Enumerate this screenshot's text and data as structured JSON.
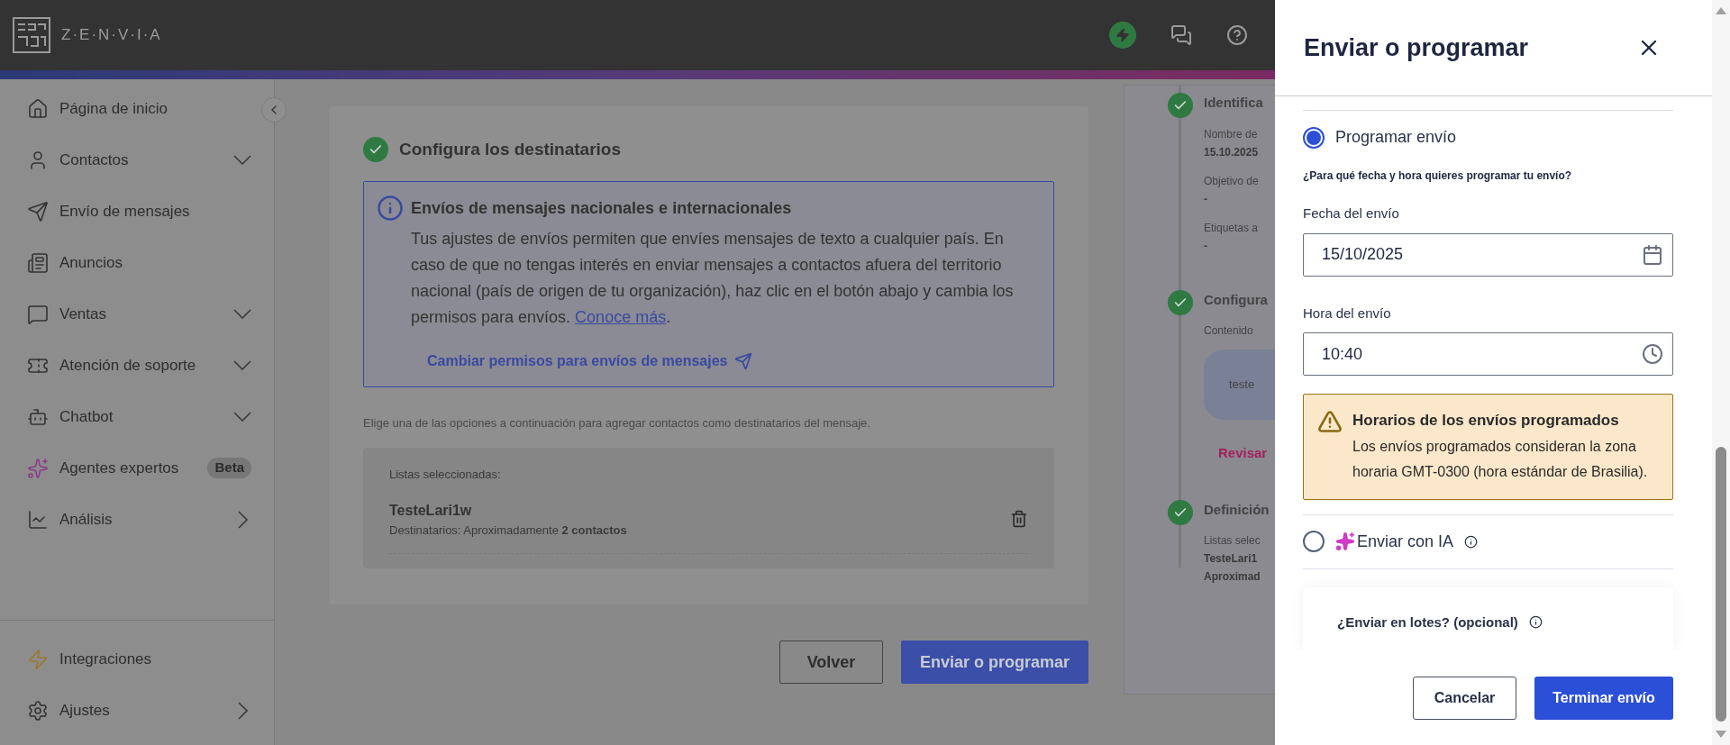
{
  "header": {
    "logo_text": "Z·E·N·V·I·A"
  },
  "sidebar": {
    "items": [
      {
        "label": "Página de inicio",
        "kind": "plain"
      },
      {
        "label": "Contactos",
        "kind": "dropdown"
      },
      {
        "label": "Envío de mensajes",
        "kind": "plain"
      },
      {
        "label": "Anuncios",
        "kind": "plain"
      },
      {
        "label": "Ventas",
        "kind": "dropdown"
      },
      {
        "label": "Atención de soporte",
        "kind": "dropdown"
      },
      {
        "label": "Chatbot",
        "kind": "dropdown"
      },
      {
        "label": "Agentes expertos",
        "kind": "plain",
        "badge": "Beta"
      },
      {
        "label": "Análisis",
        "kind": "submenu"
      }
    ],
    "bottom_items": [
      {
        "label": "Integraciones",
        "kind": "plain"
      },
      {
        "label": "Ajustes",
        "kind": "submenu"
      }
    ]
  },
  "recipients_card": {
    "title": "Configura los destinatarios",
    "notice": {
      "title": "Envíos de mensajes nacionales e internacionales",
      "text": "Tus ajustes de envíos permiten que envíes mensajes de texto a cualquier país. En caso de que no tengas interés en enviar mensajes a contactos afuera del territorio nacional (país de origen de tu organización), haz clic en el botón abajo y cambia los permisos para envíos.",
      "link": "Conoce más",
      "trailing": ".",
      "action": "Cambiar permisos para envíos de mensajes"
    },
    "helper": "Elige una de las opciones a continuación para agregar contactos como destinatarios del mensaje.",
    "lists_label": "Listas seleccionadas:",
    "lists": [
      {
        "name": "TesteLari1w",
        "detail": "Destinatarios: Aproximadamente **2 contactos**"
      }
    ]
  },
  "page_buttons": [
    {
      "label": "Volver",
      "kind": "secondary"
    },
    {
      "label": "Enviar o programar",
      "kind": "primary"
    }
  ],
  "summary": {
    "steps": [
      {
        "title": "Identifica",
        "fields": [
          {
            "label": "Nombre de",
            "value": "15.10.2025"
          },
          {
            "label": "Objetivo de",
            "value": "-"
          },
          {
            "label": "Etiquetas a",
            "value": "-"
          }
        ]
      },
      {
        "title": "Configura",
        "fields": [
          {
            "label": "Contenido"
          }
        ],
        "bubble": "teste",
        "link": "Revisar"
      },
      {
        "title": "Definición",
        "fields": [
          {
            "label": "Listas selec",
            "value": "TesteLari1"
          },
          {
            "value": "Aproximad"
          }
        ]
      }
    ]
  },
  "drawer": {
    "title": "Enviar o programar",
    "options": [
      {
        "kind": "schedule",
        "label": "Programar envío",
        "selected": true,
        "question": "¿Para qué fecha y hora quieres programar tu envío?",
        "date_label": "Fecha del envío",
        "date": "15/10/2025",
        "time_label": "Hora del envío",
        "time": "10:40",
        "warning": {
          "title": "Horarios de los envíos programados",
          "text": "Los envíos programados consideran la zona horaria GMT-0300 (hora estándar de Brasilia)."
        }
      },
      {
        "kind": "ai",
        "label": "Enviar con IA",
        "selected": false
      }
    ],
    "batch": {
      "title": "¿Enviar en lotes? (opcional)"
    },
    "buttons": [
      {
        "label": "Cancelar",
        "kind": "secondary"
      },
      {
        "label": "Terminar envío",
        "kind": "primary"
      }
    ]
  }
}
